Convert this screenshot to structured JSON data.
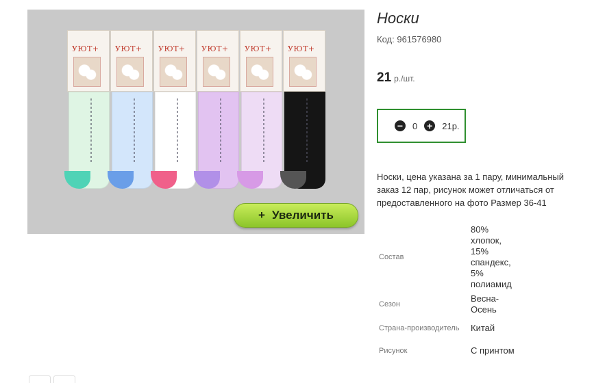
{
  "product": {
    "title": "Носки",
    "code_label": "Код:",
    "code_value": "961576980",
    "price_value": "21",
    "price_unit": "р./шт.",
    "zoom_button_label": "Увеличить",
    "zoom_button_icon": "+",
    "quantity": "0",
    "line_total": "21р.",
    "description": "Носки, цена указана за 1 пару, минимальный заказ 12 пар, рисунок может отличаться от предоставленного на фото Размер 36-41"
  },
  "photo": {
    "sock_colors": [
      "#dff5e4",
      "#d3e6fb",
      "#ffffff",
      "#e2c3f1",
      "#eedcf5",
      "#151515"
    ],
    "heel_colors": [
      "#4fd3b6",
      "#6a9ee8",
      "#f0608a",
      "#b190e8",
      "#d79ae6",
      "#555555"
    ],
    "brand": "УЮТ+"
  },
  "specs": [
    {
      "label": "Состав",
      "value": "80% хлопок, 15% спандекс, 5% полиамид"
    },
    {
      "label": "Сезон",
      "value": "Весна-Осень"
    },
    {
      "label": "Страна-производитель",
      "value": "Китай"
    },
    {
      "label": "Рисунок",
      "value": "С принтом"
    }
  ],
  "colors": {
    "qty_border": "#2f8f2f",
    "zoom_button": "#a8d63c"
  },
  "icons": {
    "minus": "minus-circle-icon",
    "plus": "plus-circle-icon"
  }
}
